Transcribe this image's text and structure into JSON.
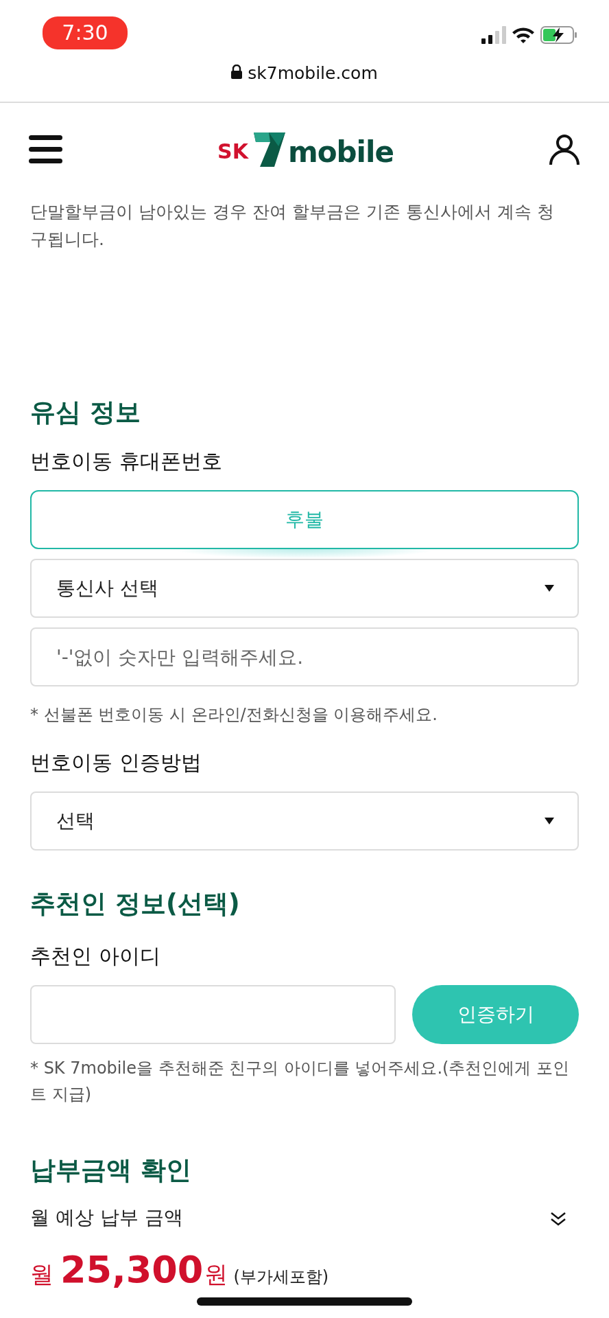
{
  "status_bar": {
    "time": "7:30"
  },
  "browser": {
    "url": "sk7mobile.com"
  },
  "header": {
    "logo_brand": "SK",
    "logo_name": "mobile"
  },
  "intro": "단말할부금이 남아있는 경우 잔여 할부금은 기존 통신사에서 계속 청구됩니다.",
  "sections": [
    {
      "title": "유심 정보",
      "fields": [
        {
          "kind": "label",
          "text": "번호이동 휴대폰번호"
        },
        {
          "kind": "toggle",
          "text": "후불",
          "selected": true
        },
        {
          "kind": "select",
          "text": "통신사 선택"
        },
        {
          "kind": "input",
          "placeholder": "'-'없이 숫자만 입력해주세요."
        },
        {
          "kind": "note",
          "text": "* 선불폰 번호이동 시 온라인/전화신청을 이용해주세요."
        },
        {
          "kind": "label",
          "text": "번호이동 인증방법"
        },
        {
          "kind": "select",
          "text": "선택"
        }
      ]
    },
    {
      "title": "추천인 정보(선택)",
      "fields": [
        {
          "kind": "label",
          "text": "추천인 아이디"
        },
        {
          "kind": "input_button",
          "button": "인증하기"
        },
        {
          "kind": "note",
          "text": "* SK 7mobile을 추천해준 친구의 아이디를 넣어주세요.(추천인에게 포인트 지급)"
        }
      ]
    },
    {
      "title": "납부금액 확인",
      "fields": [
        {
          "kind": "label_light",
          "text": "월 예상 납부 금액"
        },
        {
          "kind": "price",
          "prefix": "월",
          "amount": "25,300",
          "unit": "원",
          "suffix": "(부가세포함)"
        }
      ]
    }
  ]
}
